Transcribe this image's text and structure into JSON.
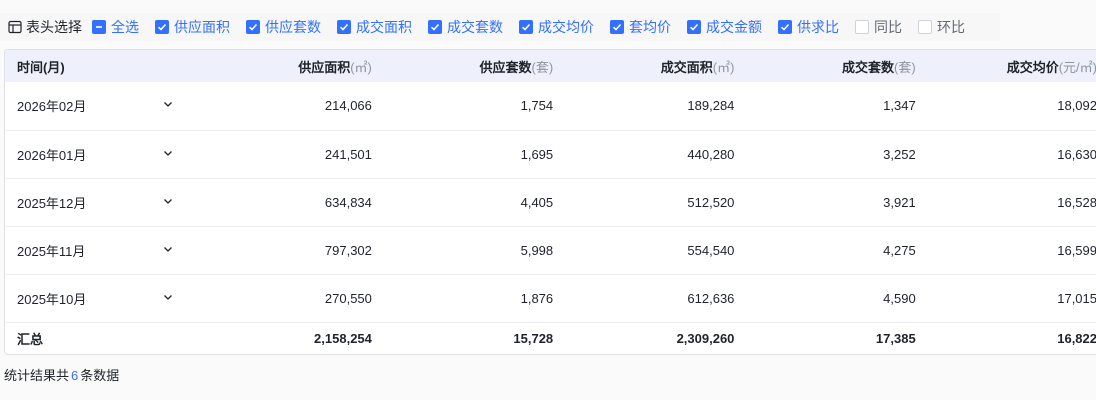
{
  "toolbar": {
    "column_picker_label": "表头选择",
    "checkboxes": [
      {
        "label": "全选",
        "state": "indeterminate"
      },
      {
        "label": "供应面积",
        "state": "checked"
      },
      {
        "label": "供应套数",
        "state": "checked"
      },
      {
        "label": "成交面积",
        "state": "checked"
      },
      {
        "label": "成交套数",
        "state": "checked"
      },
      {
        "label": "成交均价",
        "state": "checked"
      },
      {
        "label": "套均价",
        "state": "checked"
      },
      {
        "label": "成交金额",
        "state": "checked"
      },
      {
        "label": "供求比",
        "state": "checked"
      },
      {
        "label": "同比",
        "state": "unchecked"
      },
      {
        "label": "环比",
        "state": "unchecked"
      }
    ]
  },
  "table": {
    "headers": [
      {
        "name": "时间(月)",
        "unit": ""
      },
      {
        "name": "供应面积",
        "unit": "(㎡)"
      },
      {
        "name": "供应套数",
        "unit": "(套)"
      },
      {
        "name": "成交面积",
        "unit": "(㎡)"
      },
      {
        "name": "成交套数",
        "unit": "(套)"
      },
      {
        "name": "成交均价",
        "unit": "(元/㎡)"
      }
    ],
    "rows": [
      {
        "month": "2026年02月",
        "values": [
          "214,066",
          "1,754",
          "189,284",
          "1,347",
          "18,092"
        ]
      },
      {
        "month": "2026年01月",
        "values": [
          "241,501",
          "1,695",
          "440,280",
          "3,252",
          "16,630"
        ]
      },
      {
        "month": "2025年12月",
        "values": [
          "634,834",
          "4,405",
          "512,520",
          "3,921",
          "16,528"
        ]
      },
      {
        "month": "2025年11月",
        "values": [
          "797,302",
          "5,998",
          "554,540",
          "4,275",
          "16,599"
        ]
      },
      {
        "month": "2025年10月",
        "values": [
          "270,550",
          "1,876",
          "612,636",
          "4,590",
          "17,015"
        ]
      }
    ],
    "total": {
      "label": "汇总",
      "values": [
        "2,158,254",
        "15,728",
        "2,309,260",
        "17,385",
        "16,822"
      ]
    }
  },
  "footer": {
    "prefix": "统计结果共",
    "count": "6",
    "suffix": "条数据"
  },
  "colors": {
    "accent": "#3370ff",
    "header_bg": "#eef1fb"
  }
}
